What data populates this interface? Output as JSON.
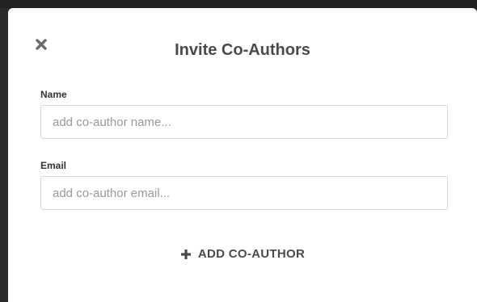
{
  "modal": {
    "title": "Invite Co-Authors",
    "close_icon": "close-icon"
  },
  "form": {
    "name_label": "Name",
    "name_placeholder": "add co-author name...",
    "name_value": "",
    "email_label": "Email",
    "email_placeholder": "add co-author email...",
    "email_value": ""
  },
  "actions": {
    "add_label": "ADD CO-AUTHOR",
    "add_icon": "plus-icon"
  },
  "colors": {
    "title_text": "#4a4a4a",
    "input_border": "#d6d6d6",
    "placeholder": "#9a9a9a",
    "icon": "#6b6b6b"
  }
}
